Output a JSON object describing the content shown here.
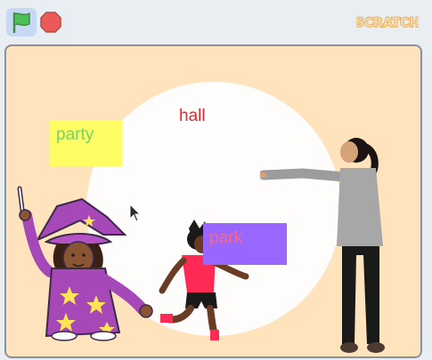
{
  "toolbar": {
    "green_flag": {
      "icon": "green-flag-icon",
      "color": "#4cbf56"
    },
    "stop": {
      "icon": "stop-sign-icon",
      "color": "#ec5959"
    },
    "logo_text": "SCRATCH"
  },
  "stage": {
    "background_color": "#ffe3bd",
    "text_boxes": [
      {
        "label": "party",
        "bg": "#fefe64",
        "color": "#73d36b"
      },
      {
        "label": "hall",
        "bg": "#fffefe",
        "color": "#e9252b"
      },
      {
        "label": "park",
        "bg": "#9966ff",
        "color": "#ff6680"
      }
    ],
    "sprites": [
      "wizard",
      "running-boy",
      "pointing-woman"
    ]
  }
}
